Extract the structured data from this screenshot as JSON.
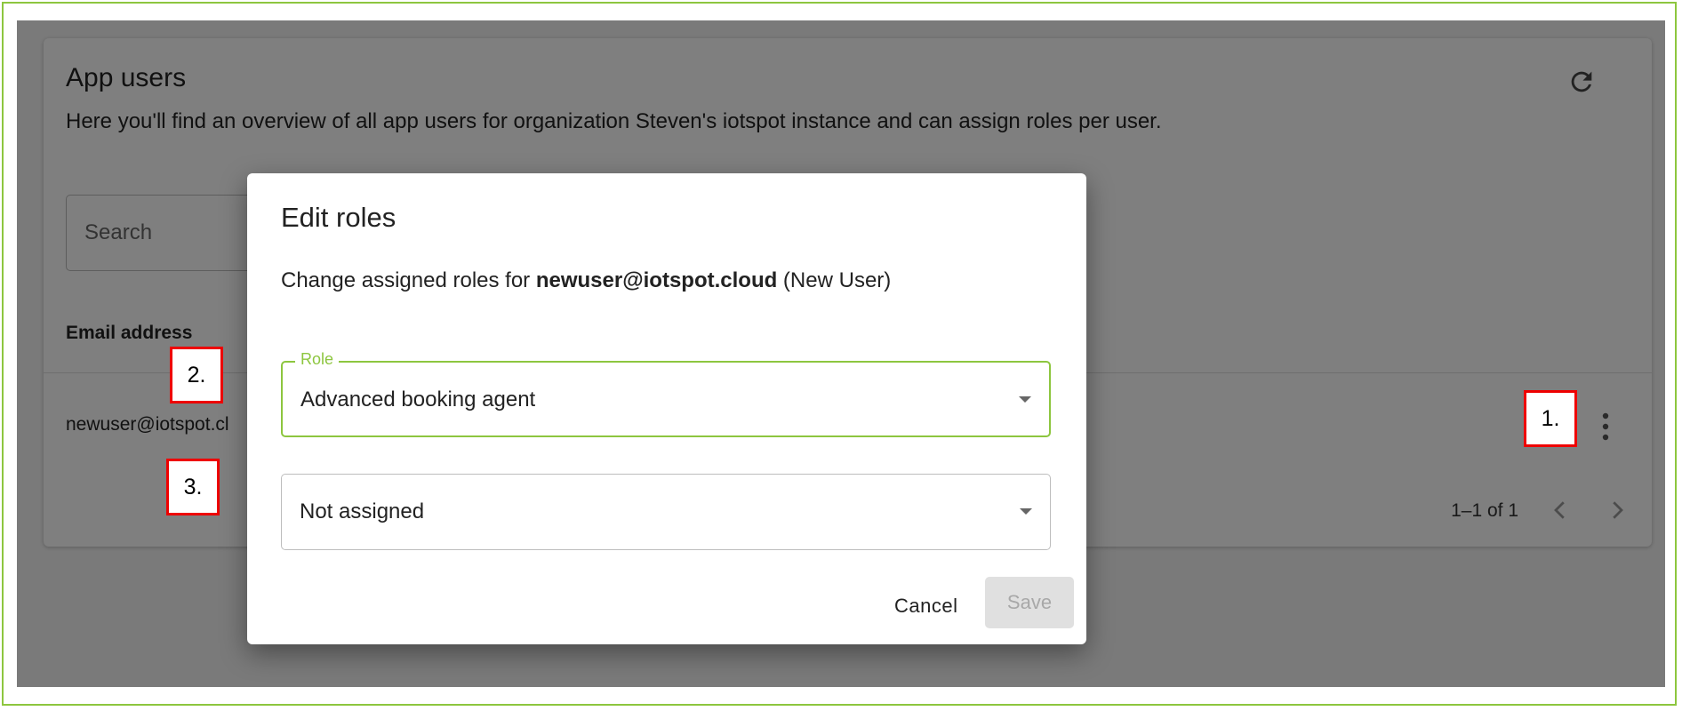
{
  "page": {
    "title": "App users",
    "description": "Here you'll find an overview of all app users for organization Steven's iotspot instance and can assign roles per user.",
    "search_placeholder": "Search",
    "column_email": "Email address",
    "row_email": "newuser@iotspot.cl",
    "pagination": "1–1 of 1"
  },
  "dialog": {
    "title": "Edit roles",
    "text_prefix": "Change assigned roles for ",
    "user_email": "newuser@iotspot.cloud",
    "user_name": " (New User)",
    "role_label": "Role",
    "role_value": "Advanced booking agent",
    "second_value": "Not assigned",
    "cancel_label": "Cancel",
    "save_label": "Save"
  },
  "callouts": [
    "1.",
    "2.",
    "3."
  ],
  "colors": {
    "accent": "#8dc63f",
    "callout_border": "#ee0000"
  },
  "icons": [
    "refresh-icon",
    "kebab-menu-icon",
    "chevron-left-icon",
    "chevron-right-icon",
    "caret-down-icon"
  ]
}
